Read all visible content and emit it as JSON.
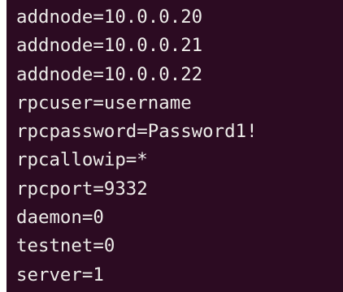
{
  "terminal": {
    "lines": [
      "addnode=10.0.0.20",
      "addnode=10.0.0.21",
      "addnode=10.0.0.22",
      "rpcuser=username",
      "rpcpassword=Password1!",
      "rpcallowip=*",
      "rpcport=9332",
      "daemon=0",
      "testnet=0",
      "server=1"
    ],
    "background_color": "#2c0b22",
    "text_color": "#ecebe8"
  }
}
